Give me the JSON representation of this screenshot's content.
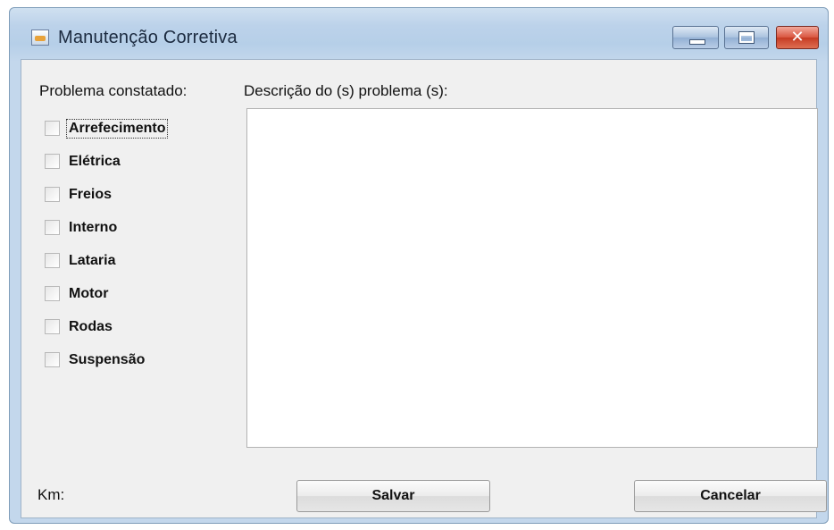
{
  "window": {
    "title": "Manutenção Corretiva",
    "icon": "java-app-icon",
    "controls": {
      "minimize": "minimize-icon",
      "maximize": "maximize-icon",
      "close": "close-icon"
    }
  },
  "form": {
    "problema_label": "Problema constatado:",
    "descricao_label": "Descrição do (s) problema (s):",
    "descricao_value": "",
    "km_label": "Km:",
    "checkboxes": [
      {
        "label": "Arrefecimento",
        "checked": false
      },
      {
        "label": "Elétrica",
        "checked": false
      },
      {
        "label": "Freios",
        "checked": false
      },
      {
        "label": "Interno",
        "checked": false
      },
      {
        "label": "Lataria",
        "checked": false
      },
      {
        "label": "Motor",
        "checked": false
      },
      {
        "label": "Rodas",
        "checked": false
      },
      {
        "label": "Suspensão",
        "checked": false
      }
    ],
    "save_label": "Salvar",
    "cancel_label": "Cancelar"
  }
}
